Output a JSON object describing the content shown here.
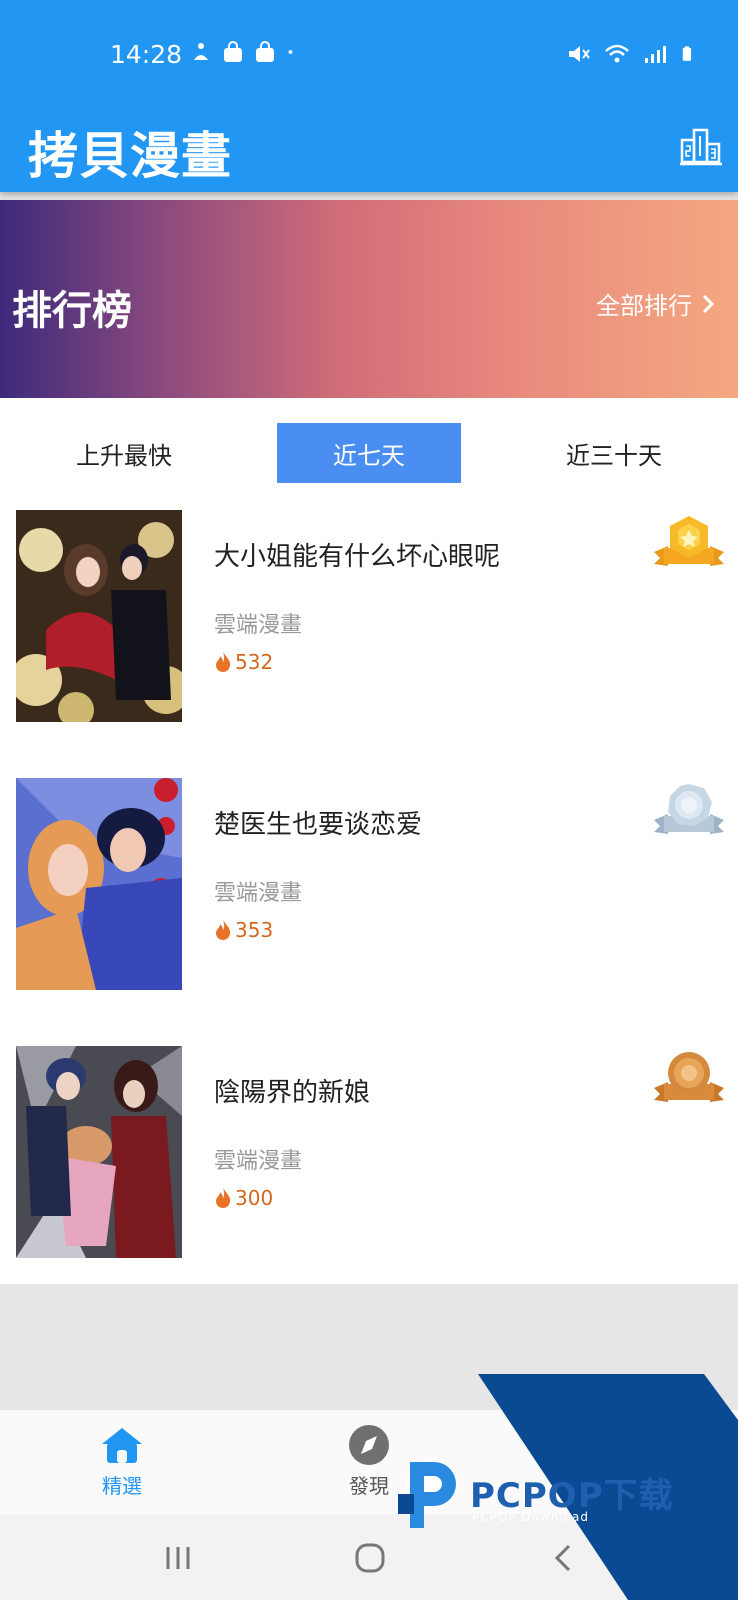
{
  "status_bar": {
    "time": "14:28"
  },
  "app_bar": {
    "title": "拷貝漫畫",
    "ranking_icon": "podium-icon"
  },
  "banner": {
    "title": "排行榜",
    "more_label": "全部排行"
  },
  "tabs": [
    {
      "label": "上升最快",
      "active": false
    },
    {
      "label": "近七天",
      "active": true
    },
    {
      "label": "近三十天",
      "active": false
    }
  ],
  "items": [
    {
      "title": "大小姐能有什么坏心眼呢",
      "author": "雲端漫畫",
      "heat": "532",
      "medal": "gold"
    },
    {
      "title": "楚医生也要谈恋爱",
      "author": "雲端漫畫",
      "heat": "353",
      "medal": "silver"
    },
    {
      "title": "陰陽界的新娘",
      "author": "雲端漫畫",
      "heat": "300",
      "medal": "bronze"
    }
  ],
  "bottom_nav": [
    {
      "label": "精選",
      "icon": "home-icon",
      "active": true,
      "color": "#2196f3"
    },
    {
      "label": "發現",
      "icon": "compass-icon",
      "active": false
    }
  ],
  "watermark": {
    "text": "PCPOP下载",
    "subtext": "PCPOP Download"
  },
  "colors": {
    "primary": "#2196f3",
    "tab_active": "#4a8ef2",
    "heat": "#d2691e"
  }
}
